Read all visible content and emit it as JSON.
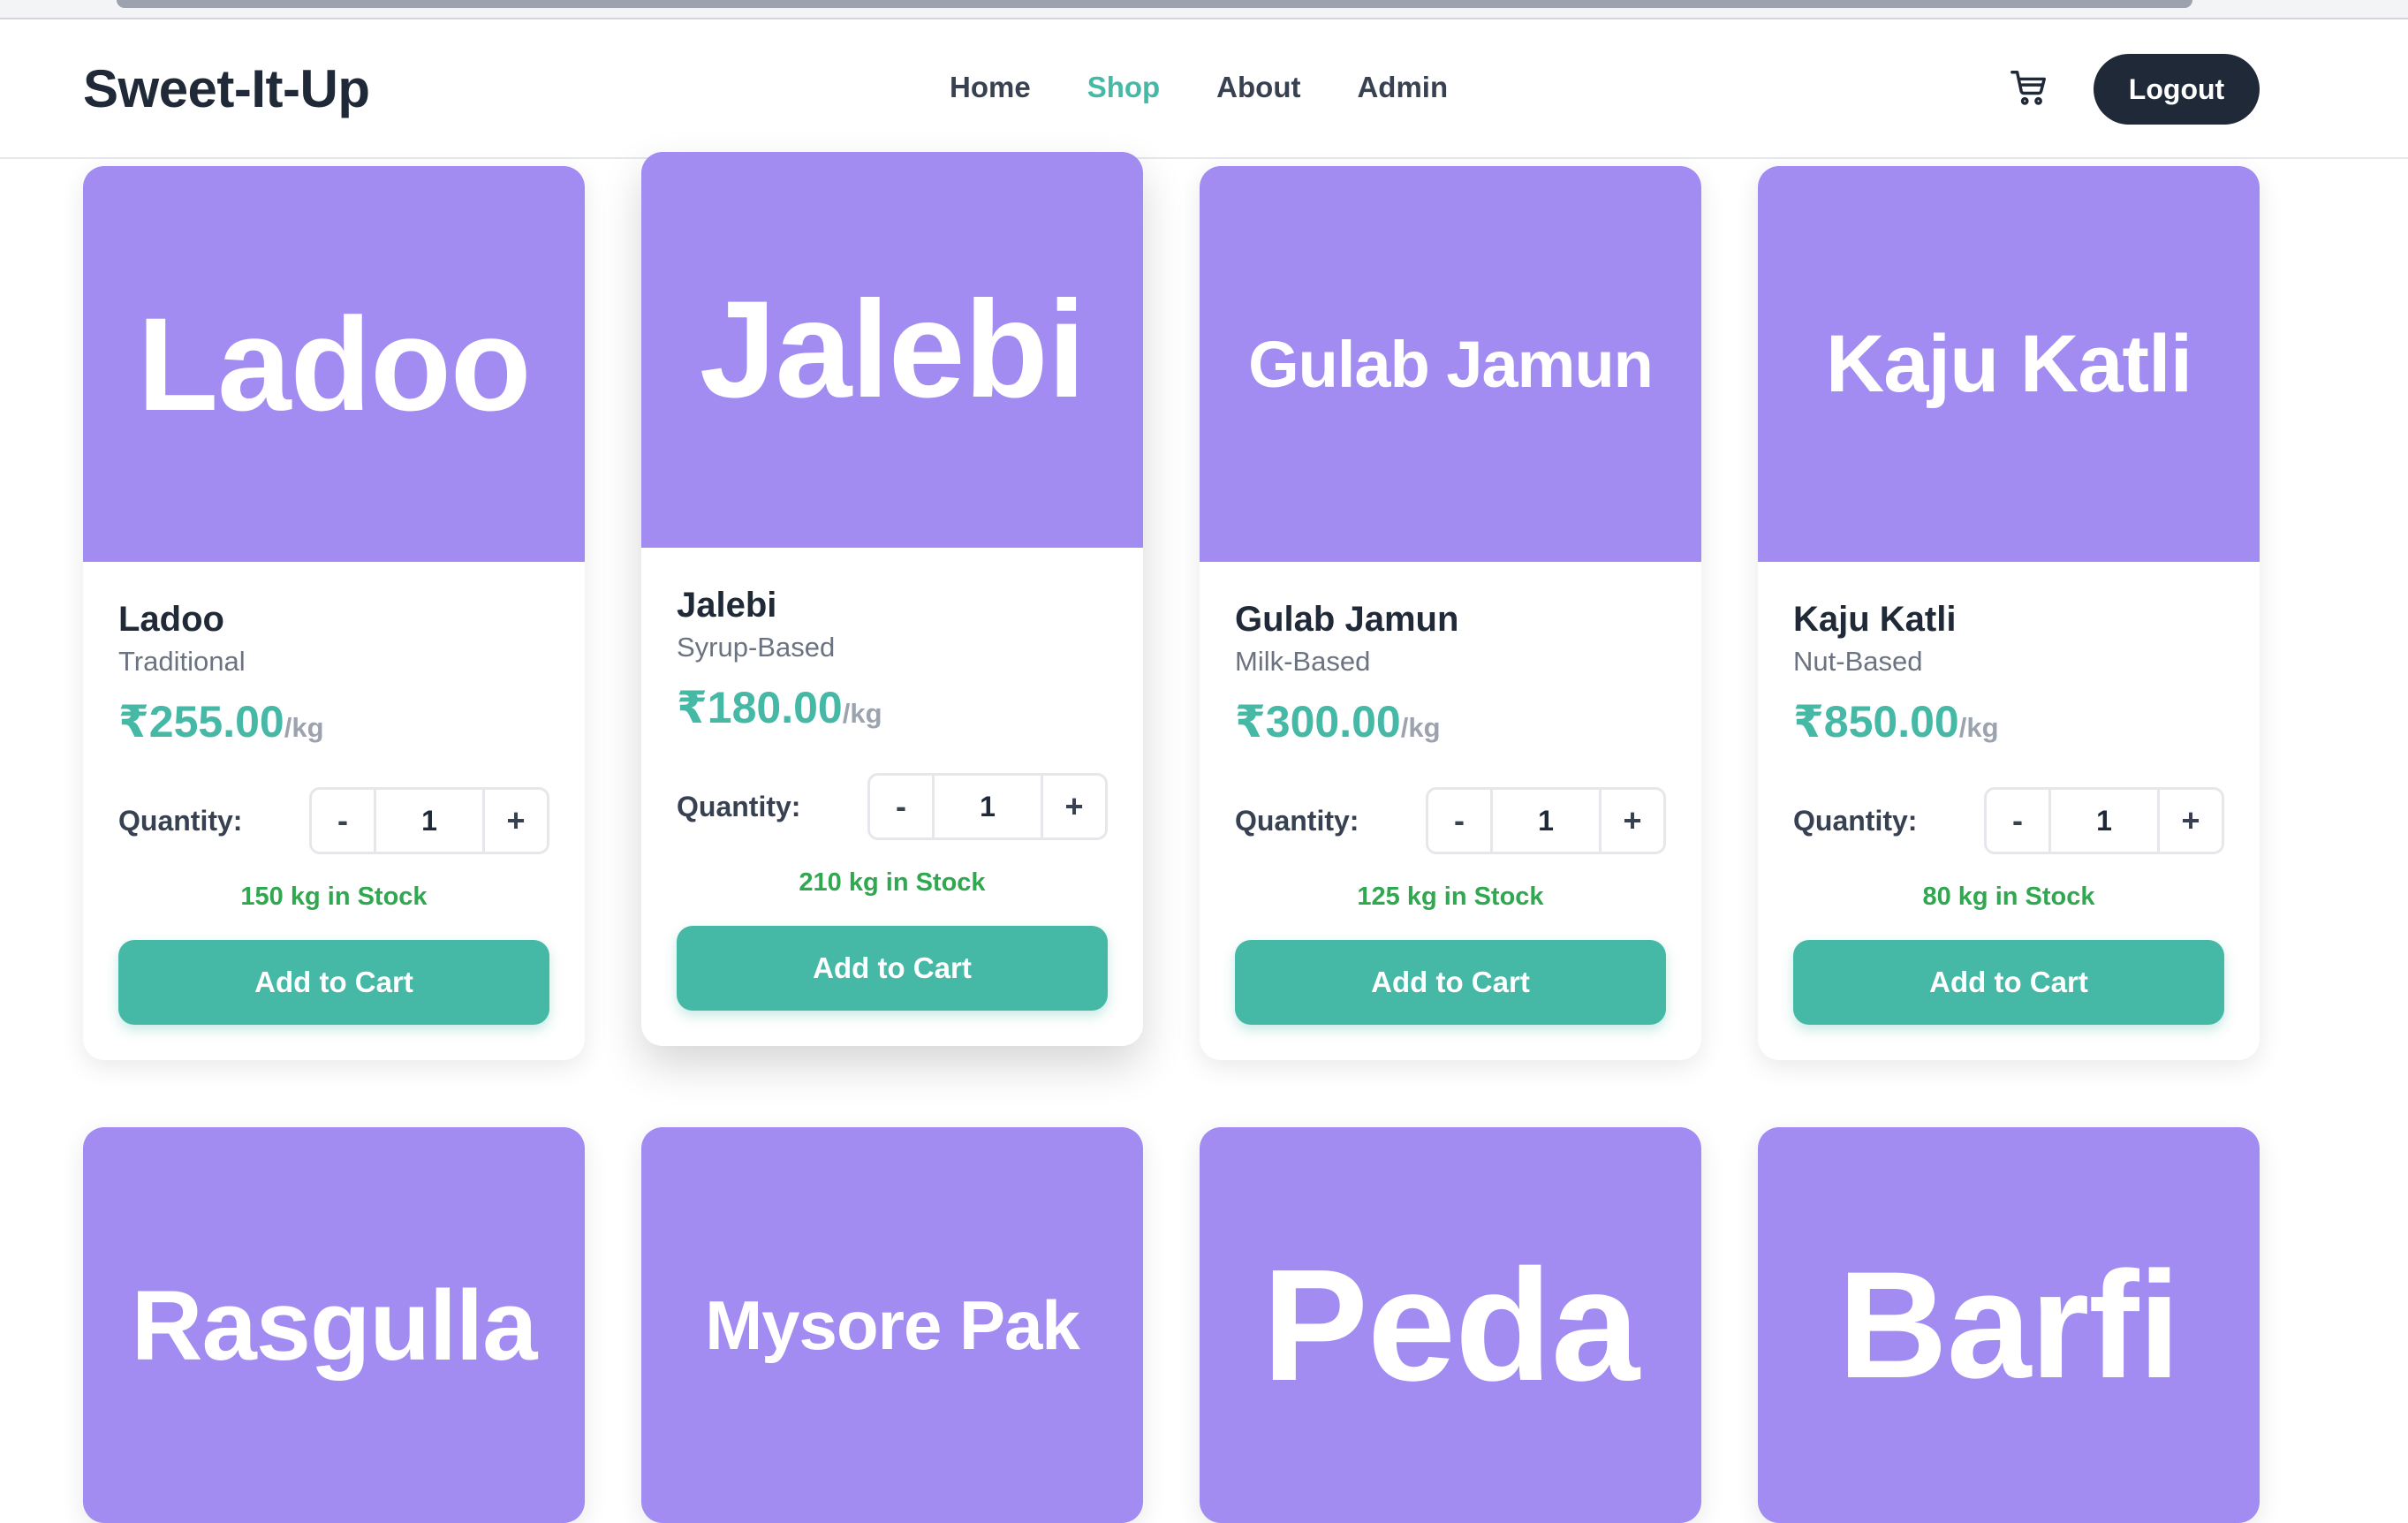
{
  "header": {
    "logo": "Sweet-It-Up",
    "nav": [
      "Home",
      "Shop",
      "About",
      "Admin"
    ],
    "active_nav": "Shop",
    "logout_label": "Logout"
  },
  "labels": {
    "quantity": "Quantity:",
    "add_to_cart": "Add to Cart",
    "per_unit": "/kg",
    "minus": "-",
    "plus": "+"
  },
  "products": [
    {
      "name": "Ladoo",
      "category": "Traditional",
      "price": "₹255.00",
      "qty": "1",
      "stock": "150 kg in Stock"
    },
    {
      "name": "Jalebi",
      "category": "Syrup-Based",
      "price": "₹180.00",
      "qty": "1",
      "stock": "210 kg in Stock"
    },
    {
      "name": "Gulab Jamun",
      "category": "Milk-Based",
      "price": "₹300.00",
      "qty": "1",
      "stock": "125 kg in Stock"
    },
    {
      "name": "Kaju Katli",
      "category": "Nut-Based",
      "price": "₹850.00",
      "qty": "1",
      "stock": "80 kg in Stock"
    },
    {
      "name": "Rasgulla"
    },
    {
      "name": "Mysore Pak"
    },
    {
      "name": "Peda"
    },
    {
      "name": "Barfi"
    }
  ],
  "colors": {
    "accent": "#45b8a6",
    "image_bg": "#a28bf1",
    "stock": "#2fa84f",
    "dark": "#1f2937"
  },
  "icons": {
    "cart": "cart-icon"
  }
}
